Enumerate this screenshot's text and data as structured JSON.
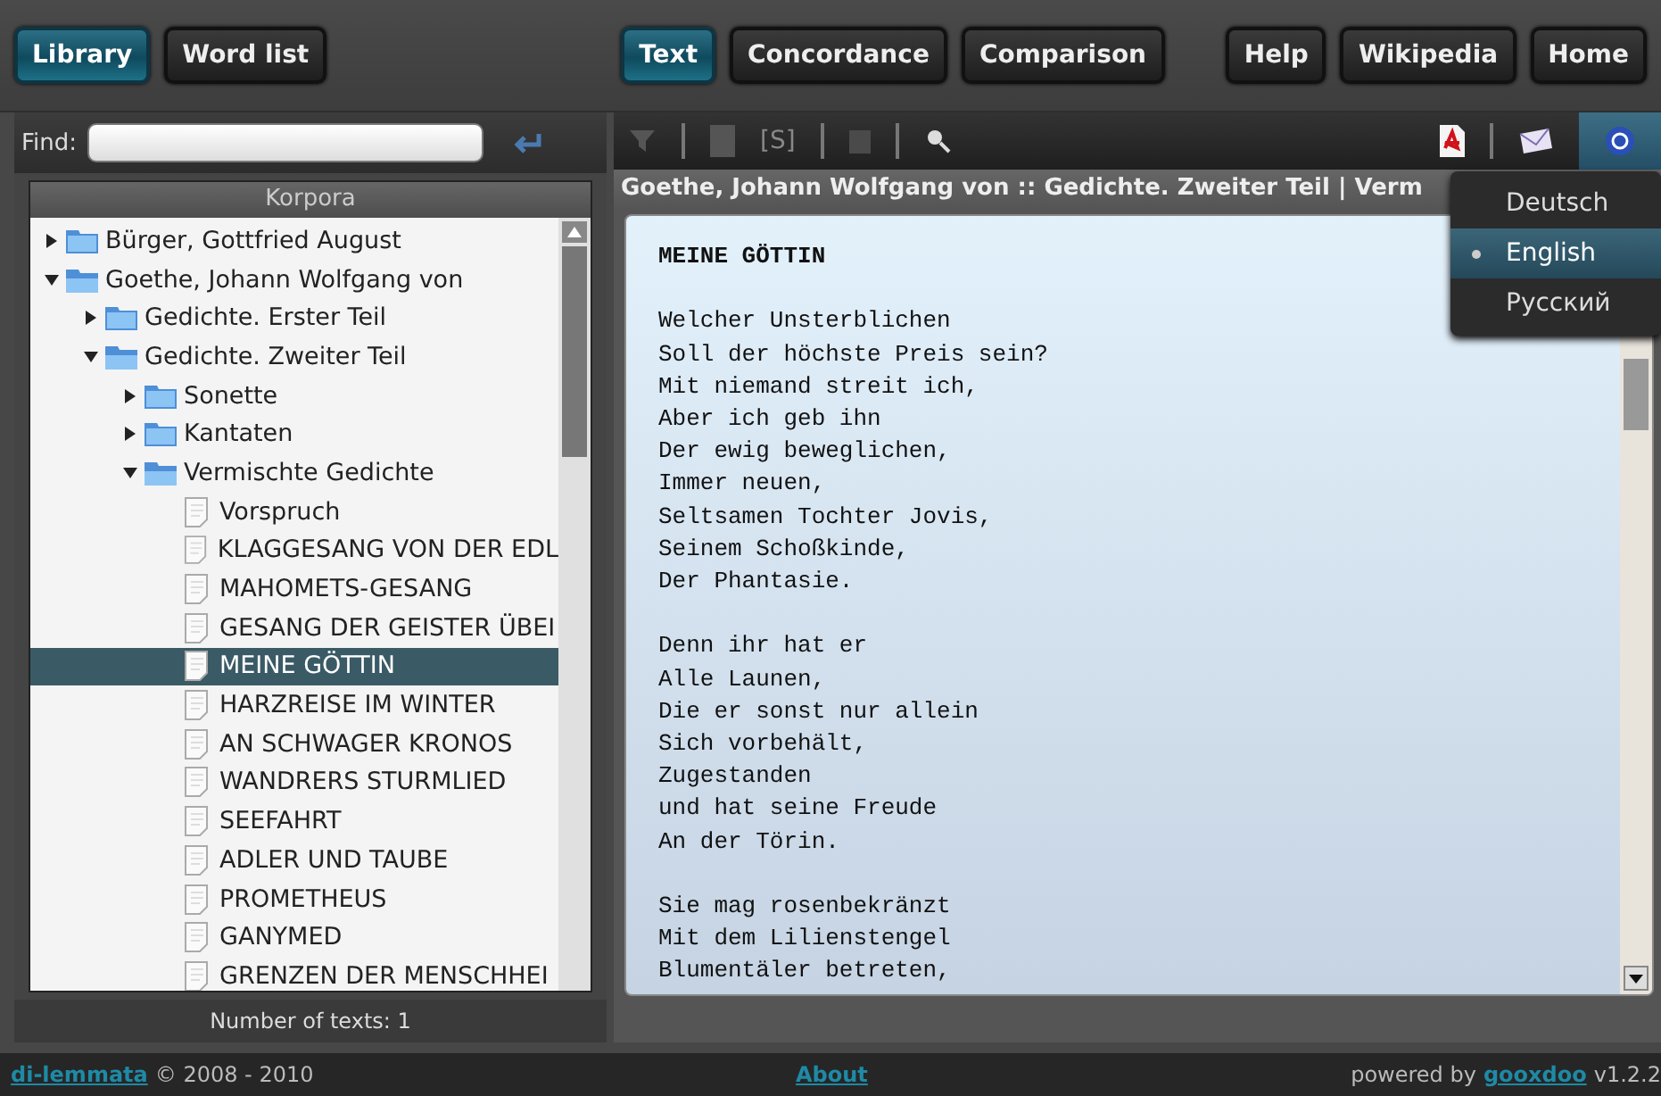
{
  "left_tabs": [
    {
      "label": "Library",
      "selected": true
    },
    {
      "label": "Word list",
      "selected": false
    }
  ],
  "right_tabs": [
    {
      "label": "Text",
      "selected": true
    },
    {
      "label": "Concordance",
      "selected": false
    },
    {
      "label": "Comparison",
      "selected": false
    }
  ],
  "nav_buttons": [
    "Help",
    "Wikipedia",
    "Home"
  ],
  "find": {
    "label": "Find:"
  },
  "tree": {
    "header": "Korpora",
    "items": [
      {
        "label": "Bürger, Gottfried August",
        "kind": "folder",
        "expanded": false,
        "selected": false
      },
      {
        "label": "Goethe, Johann Wolfgang von",
        "kind": "folder",
        "expanded": true,
        "selected": false,
        "children": [
          {
            "label": "Gedichte. Erster Teil",
            "kind": "folder",
            "expanded": false,
            "selected": false
          },
          {
            "label": "Gedichte. Zweiter Teil",
            "kind": "folder",
            "expanded": true,
            "selected": false,
            "children": [
              {
                "label": "Sonette",
                "kind": "folder",
                "expanded": false,
                "selected": false
              },
              {
                "label": "Kantaten",
                "kind": "folder",
                "expanded": false,
                "selected": false
              },
              {
                "label": "Vermischte Gedichte",
                "kind": "folder",
                "expanded": true,
                "selected": false,
                "children": [
                  {
                    "label": "Vorspruch",
                    "kind": "text",
                    "selected": false
                  },
                  {
                    "label": "KLAGGESANG VON DER EDL",
                    "kind": "text",
                    "selected": false
                  },
                  {
                    "label": "MAHOMETS-GESANG",
                    "kind": "text",
                    "selected": false
                  },
                  {
                    "label": "GESANG DER GEISTER ÜBEI",
                    "kind": "text",
                    "selected": false
                  },
                  {
                    "label": "MEINE GÖTTIN",
                    "kind": "text",
                    "selected": true
                  },
                  {
                    "label": "HARZREISE IM WINTER",
                    "kind": "text",
                    "selected": false
                  },
                  {
                    "label": "AN SCHWAGER KRONOS",
                    "kind": "text",
                    "selected": false
                  },
                  {
                    "label": "WANDRERS STURMLIED",
                    "kind": "text",
                    "selected": false
                  },
                  {
                    "label": "SEEFAHRT",
                    "kind": "text",
                    "selected": false
                  },
                  {
                    "label": "ADLER UND TAUBE",
                    "kind": "text",
                    "selected": false
                  },
                  {
                    "label": "PROMETHEUS",
                    "kind": "text",
                    "selected": false
                  },
                  {
                    "label": "GANYMED",
                    "kind": "text",
                    "selected": false
                  },
                  {
                    "label": "GRENZEN DER MENSCHHEI",
                    "kind": "text",
                    "selected": false
                  }
                ]
              }
            ]
          }
        ]
      }
    ]
  },
  "count": "Number of texts: 1",
  "toolbar": {
    "stopwords": "[S]"
  },
  "text_title": "Goethe, Johann Wolfgang von :: Gedichte. Zweiter Teil | Verm",
  "poem": {
    "title": "MEINE GÖTTIN",
    "stanzas": [
      [
        "Welcher Unsterblichen",
        "Soll der höchste Preis sein?",
        "Mit niemand streit ich,",
        "Aber ich geb ihn",
        "Der ewig beweglichen,",
        "Immer neuen,",
        "Seltsamen Tochter Jovis,",
        "Seinem Schoßkinde,",
        "Der Phantasie."
      ],
      [
        "Denn ihr hat er",
        "Alle Launen,",
        "Die er sonst nur allein",
        "Sich vorbehält,",
        "Zugestanden",
        "und hat seine Freude",
        "An der Törin."
      ],
      [
        "Sie mag rosenbekränzt",
        "Mit dem Lilienstengel",
        "Blumentäler betreten,"
      ]
    ]
  },
  "language_menu": [
    {
      "label": "Deutsch",
      "selected": false
    },
    {
      "label": "English",
      "selected": true
    },
    {
      "label": "Русский",
      "selected": false
    }
  ],
  "footer": {
    "brand": "di-lemmata",
    "copyright": "© 2008 - 2010",
    "about": "About",
    "powered": "powered by",
    "engine": "gooxdoo",
    "version": "v1.2.2"
  }
}
